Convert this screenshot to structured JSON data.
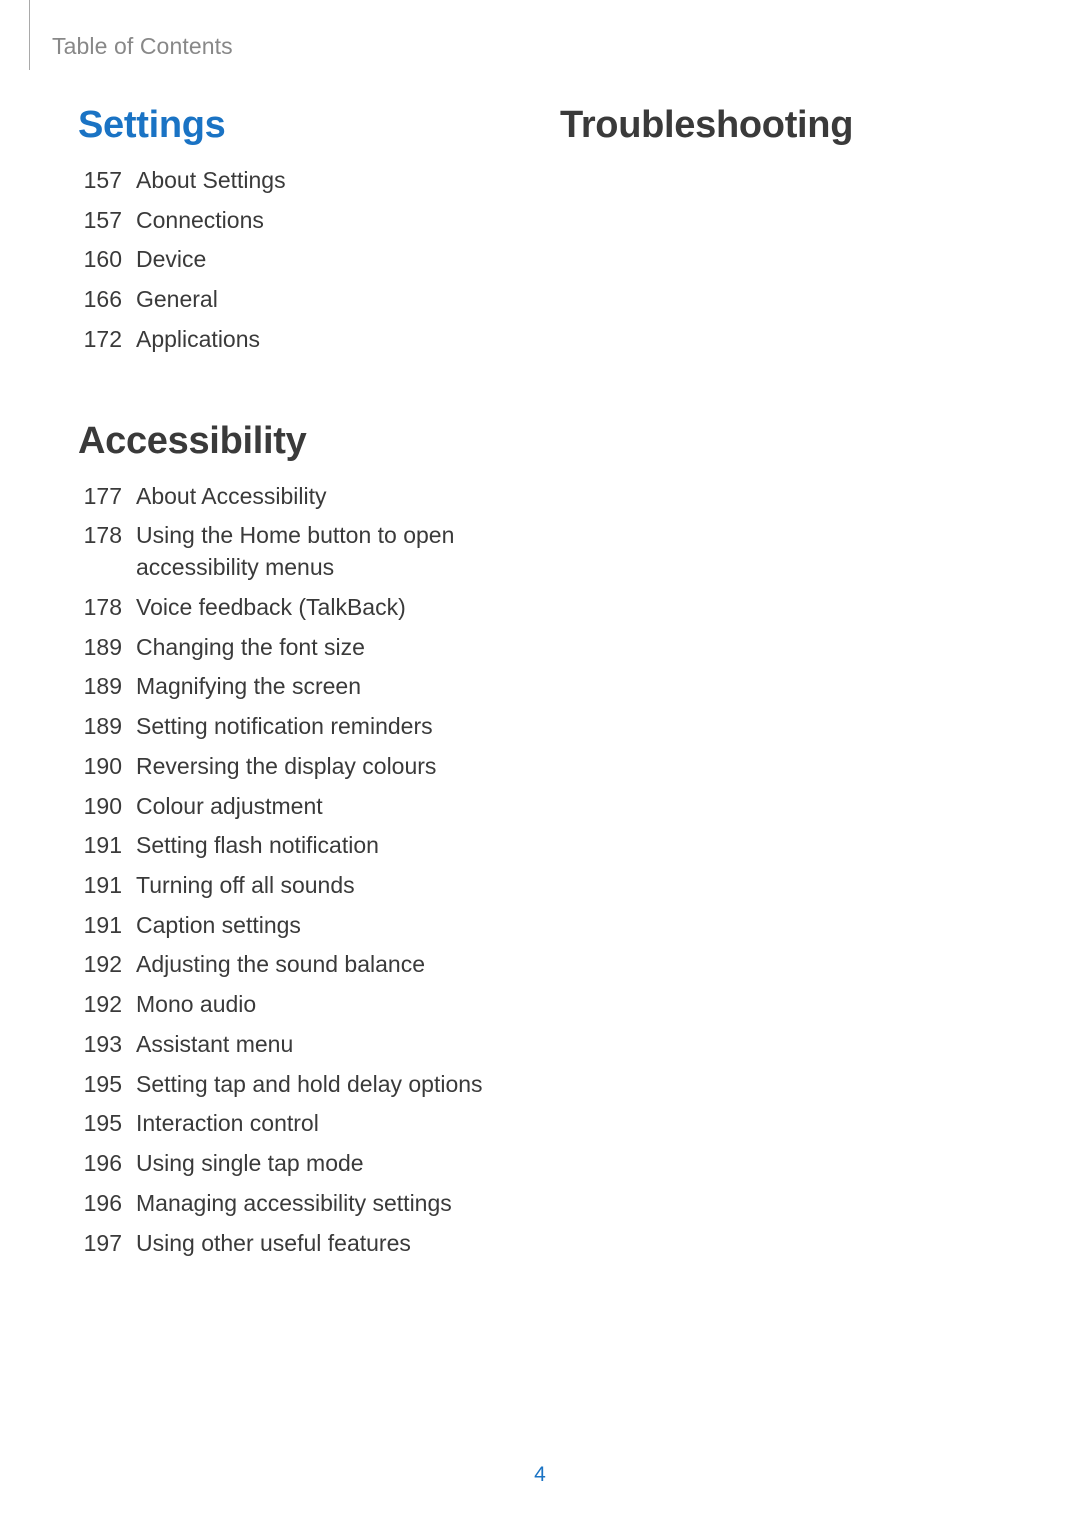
{
  "running_head": "Table of Contents",
  "page_number": "4",
  "left_column": {
    "sections": [
      {
        "heading": "Settings",
        "is_link": true,
        "items": [
          {
            "page": "157",
            "title": "About Settings"
          },
          {
            "page": "157",
            "title": "Connections"
          },
          {
            "page": "160",
            "title": "Device"
          },
          {
            "page": "166",
            "title": "General"
          },
          {
            "page": "172",
            "title": "Applications"
          }
        ]
      },
      {
        "heading": "Accessibility",
        "is_link": false,
        "items": [
          {
            "page": "177",
            "title": "About Accessibility"
          },
          {
            "page": "178",
            "title": "Using the Home button to open accessibility menus"
          },
          {
            "page": "178",
            "title": "Voice feedback (TalkBack)"
          },
          {
            "page": "189",
            "title": "Changing the font size"
          },
          {
            "page": "189",
            "title": "Magnifying the screen"
          },
          {
            "page": "189",
            "title": "Setting notification reminders"
          },
          {
            "page": "190",
            "title": "Reversing the display colours"
          },
          {
            "page": "190",
            "title": "Colour adjustment"
          },
          {
            "page": "191",
            "title": "Setting flash notification"
          },
          {
            "page": "191",
            "title": "Turning off all sounds"
          },
          {
            "page": "191",
            "title": "Caption settings"
          },
          {
            "page": "192",
            "title": "Adjusting the sound balance"
          },
          {
            "page": "192",
            "title": "Mono audio"
          },
          {
            "page": "193",
            "title": "Assistant menu"
          },
          {
            "page": "195",
            "title": "Setting tap and hold delay options"
          },
          {
            "page": "195",
            "title": "Interaction control"
          },
          {
            "page": "196",
            "title": "Using single tap mode"
          },
          {
            "page": "196",
            "title": "Managing accessibility settings"
          },
          {
            "page": "197",
            "title": "Using other useful features"
          }
        ]
      }
    ]
  },
  "right_column": {
    "sections": [
      {
        "heading": "Troubleshooting",
        "is_link": false,
        "items": []
      }
    ]
  }
}
